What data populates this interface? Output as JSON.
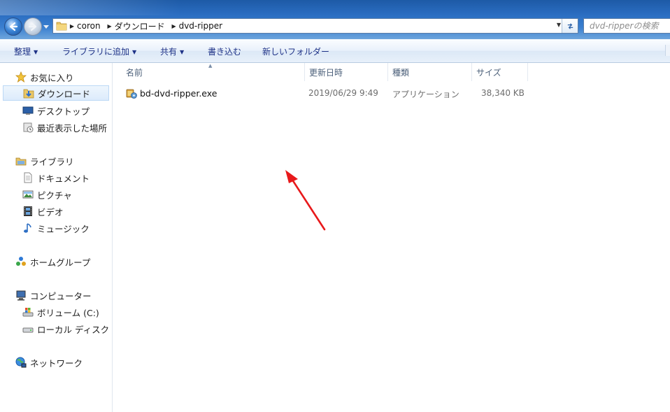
{
  "address": {
    "crumbs": [
      "coron",
      "ダウンロード",
      "dvd-ripper"
    ],
    "search_placeholder": "dvd-ripperの検索"
  },
  "toolbar": {
    "organize": "整理",
    "include_library": "ライブラリに追加",
    "share": "共有",
    "burn": "書き込む",
    "new_folder": "新しいフォルダー"
  },
  "nav": {
    "favorites": "お気に入り",
    "downloads": "ダウンロード",
    "desktop": "デスクトップ",
    "recent": "最近表示した場所",
    "libraries": "ライブラリ",
    "documents": "ドキュメント",
    "pictures": "ピクチャ",
    "videos": "ビデオ",
    "music": "ミュージック",
    "homegroup": "ホームグループ",
    "computer": "コンピューター",
    "volume_c": "ボリューム (C:)",
    "local_disk": "ローカル ディスク (",
    "network": "ネットワーク"
  },
  "columns": {
    "name": "名前",
    "modified": "更新日時",
    "type": "種類",
    "size": "サイズ"
  },
  "files": [
    {
      "name": "bd-dvd-ripper.exe",
      "modified": "2019/06/29 9:49",
      "type": "アプリケーション",
      "size": "38,340 KB"
    }
  ],
  "colors": {
    "annotation_arrow": "#e8191b",
    "toolbar_text": "#1e3287",
    "selected_bg": "#dcebfc"
  }
}
